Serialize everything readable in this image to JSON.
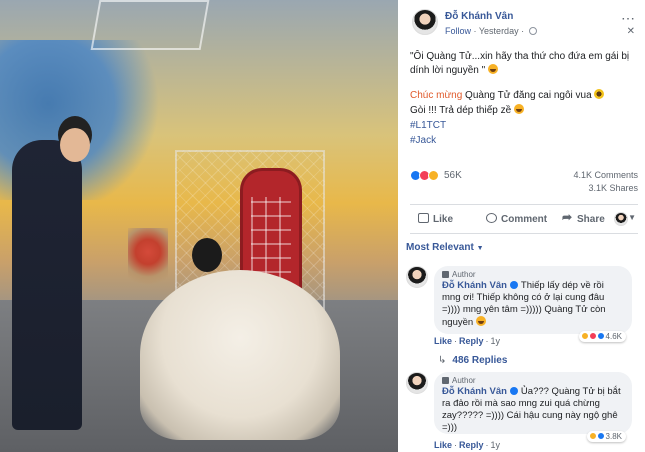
{
  "post": {
    "author": "Đỗ Khánh Vân",
    "follow": "Follow",
    "time": "Yesterday",
    "caption_line1": "\"Ôi Quàng Tử...xin hãy tha thứ cho đứa em gái bị dính lời nguyền \"",
    "caption_congrats": "Chúc mừng",
    "caption_line2_rest": " Quàng Tử đăng cai ngôi vua",
    "caption_line3": "Gòi !!! Trả dép thiếp zề",
    "hashtag1": "#L1TCT",
    "hashtag2": "#Jack"
  },
  "stats": {
    "reactions": "56K",
    "comments": "4.1K Comments",
    "shares": "3.1K Shares"
  },
  "actions": {
    "like": "Like",
    "comment": "Comment",
    "share": "Share"
  },
  "sort_label": "Most Relevant",
  "comments": [
    {
      "badge": "Author",
      "name": "Đỗ Khánh Vân",
      "text": "Thiếp lấy dép về rồi mng ơi! Thiếp không có ở lại cung đâu =)))) mng yên tâm =))))) Quàng Tử còn nguyền",
      "reactions": "4.6K",
      "like": "Like",
      "reply": "Reply",
      "time": "1y"
    },
    {
      "badge": "Author",
      "name": "Đỗ Khánh Vân",
      "text": "Ủa??? Quàng Tử bị bắt ra đảo rồi mà sao mng zui quá chừng zay????? =)))) Cái hậu cung này ngộ ghê =)))",
      "reactions": "3.8K",
      "like": "Like",
      "reply": "Reply",
      "time": "1y"
    }
  ],
  "replies_label": "486 Replies",
  "colors": {
    "link": "#385898",
    "highlight": "#e05a2b",
    "like_blue": "#1877f2",
    "love_red": "#f33e58",
    "haha_yellow": "#f7b125"
  }
}
